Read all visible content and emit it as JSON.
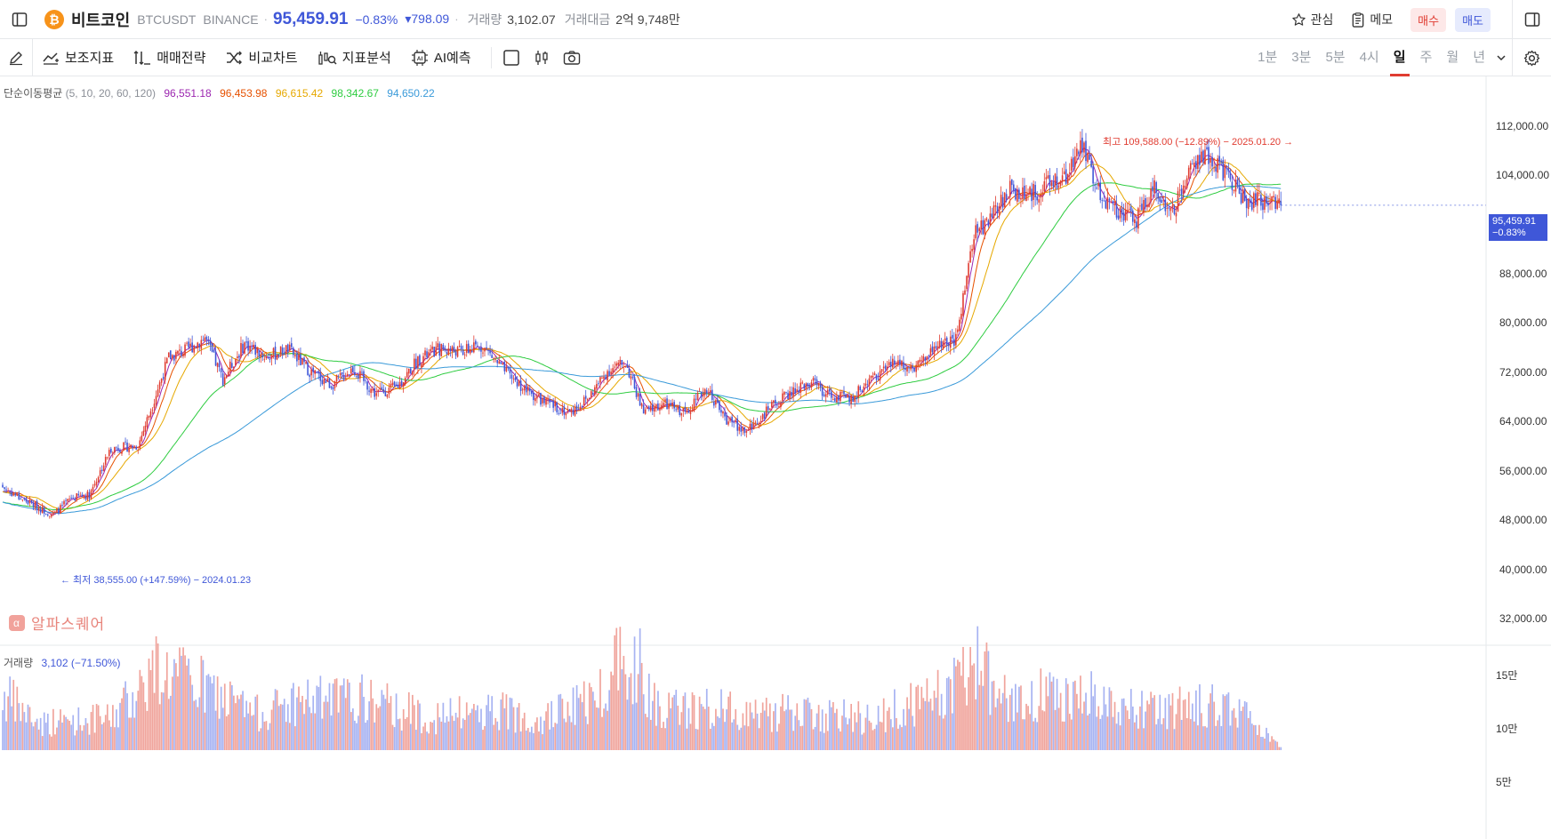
{
  "header": {
    "coin_symbol_glyph": "₿",
    "coin_name": "비트코인",
    "pair": "BTCUSDT",
    "exchange": "BINANCE",
    "price": "95,459.91",
    "change_pct": "−0.83%",
    "change_abs": "▾798.09",
    "volume_label": "거래량",
    "volume_value": "3,102.07",
    "turnover_label": "거래대금",
    "turnover_value": "2억 9,748만",
    "watch_label": "관심",
    "memo_label": "메모",
    "buy_label": "매수",
    "sell_label": "매도"
  },
  "toolbar": {
    "items": [
      "보조지표",
      "매매전략",
      "비교차트",
      "지표분석",
      "AI예측"
    ],
    "timeframes": [
      "1분",
      "3분",
      "5분",
      "4시",
      "일",
      "주",
      "월",
      "년"
    ],
    "active_timeframe": "일"
  },
  "ma_legend": {
    "title": "단순이동평균",
    "params": "(5, 10, 20, 60, 120)",
    "values": [
      "96,551.18",
      "96,453.98",
      "96,615.42",
      "98,342.67",
      "94,650.22"
    ],
    "colors": [
      "#9c27b0",
      "#e65100",
      "#e6a800",
      "#2ecc40",
      "#3a9ad9"
    ]
  },
  "annotations": {
    "high": "최고 109,588.00 (−12.89%) − 2025.01.20 →",
    "low": "← 최저 38,555.00 (+147.59%) − 2024.01.23"
  },
  "price_tag": {
    "price": "95,459.91",
    "change": "−0.83%"
  },
  "watermark": {
    "glyph": "α",
    "text": "알파스퀘어"
  },
  "volume_legend": {
    "label": "거래량",
    "value": "3,102 (−71.50%)"
  },
  "colors": {
    "up": "#e03c31",
    "down": "#3f57d8",
    "up_vol": "#f0a49c",
    "down_vol": "#a7b3f2"
  },
  "chart_data": {
    "type": "candlestick",
    "price_axis_ticks": [
      "112,000.00",
      "104,000.00",
      "88,000.00",
      "80,000.00",
      "72,000.00",
      "64,000.00",
      "56,000.00",
      "48,000.00",
      "40,000.00",
      "32,000.00"
    ],
    "volume_axis_ticks": [
      "15만",
      "10만",
      "5만"
    ],
    "ylim": [
      30000,
      122000
    ],
    "close_anchors": [
      [
        0,
        44500
      ],
      [
        10,
        42500
      ],
      [
        20,
        40800
      ],
      [
        28,
        39500
      ],
      [
        38,
        42500
      ],
      [
        48,
        43200
      ],
      [
        60,
        51500
      ],
      [
        75,
        52000
      ],
      [
        92,
        68000
      ],
      [
        100,
        69000
      ],
      [
        112,
        71500
      ],
      [
        122,
        64000
      ],
      [
        134,
        70500
      ],
      [
        146,
        68000
      ],
      [
        158,
        69500
      ],
      [
        170,
        65500
      ],
      [
        182,
        63000
      ],
      [
        194,
        66000
      ],
      [
        206,
        61500
      ],
      [
        218,
        62500
      ],
      [
        230,
        67500
      ],
      [
        242,
        69500
      ],
      [
        255,
        69000
      ],
      [
        266,
        70000
      ],
      [
        278,
        65500
      ],
      [
        290,
        62000
      ],
      [
        302,
        59500
      ],
      [
        314,
        58000
      ],
      [
        324,
        60500
      ],
      [
        335,
        65500
      ],
      [
        345,
        67000
      ],
      [
        355,
        58000
      ],
      [
        366,
        59500
      ],
      [
        378,
        58000
      ],
      [
        390,
        62500
      ],
      [
        400,
        57000
      ],
      [
        412,
        54500
      ],
      [
        424,
        58500
      ],
      [
        436,
        61500
      ],
      [
        448,
        63500
      ],
      [
        458,
        61000
      ],
      [
        470,
        60500
      ],
      [
        482,
        64500
      ],
      [
        494,
        67000
      ],
      [
        506,
        66500
      ],
      [
        518,
        70000
      ],
      [
        528,
        71000
      ],
      [
        538,
        90000
      ],
      [
        548,
        93500
      ],
      [
        558,
        98500
      ],
      [
        568,
        97000
      ],
      [
        578,
        99000
      ],
      [
        588,
        100500
      ],
      [
        598,
        106500
      ],
      [
        608,
        97000
      ],
      [
        618,
        94500
      ],
      [
        628,
        93000
      ],
      [
        638,
        98500
      ],
      [
        648,
        94000
      ],
      [
        658,
        102500
      ],
      [
        668,
        104500
      ],
      [
        678,
        101000
      ],
      [
        688,
        96500
      ],
      [
        698,
        96000
      ],
      [
        708,
        95459.91
      ]
    ],
    "volume_anchors": [
      [
        0,
        60000
      ],
      [
        20,
        30000
      ],
      [
        60,
        35000
      ],
      [
        85,
        90000
      ],
      [
        110,
        70000
      ],
      [
        140,
        40000
      ],
      [
        165,
        55000
      ],
      [
        200,
        55000
      ],
      [
        240,
        35000
      ],
      [
        270,
        45000
      ],
      [
        300,
        35000
      ],
      [
        330,
        60000
      ],
      [
        345,
        120000
      ],
      [
        365,
        45000
      ],
      [
        400,
        45000
      ],
      [
        440,
        40000
      ],
      [
        480,
        35000
      ],
      [
        520,
        60000
      ],
      [
        540,
        95000
      ],
      [
        560,
        50000
      ],
      [
        580,
        65000
      ],
      [
        610,
        55000
      ],
      [
        640,
        40000
      ],
      [
        660,
        55000
      ],
      [
        690,
        35000
      ],
      [
        708,
        3102
      ]
    ]
  }
}
